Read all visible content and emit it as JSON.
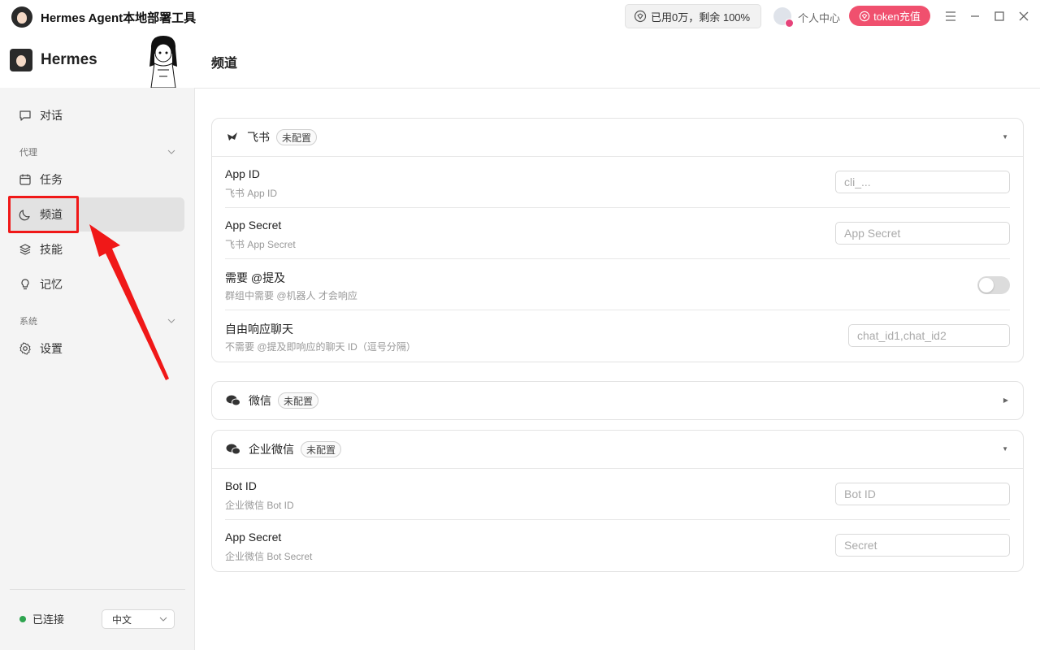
{
  "app": {
    "title": "Hermes Agent本地部署工具",
    "usage": "已用0万，剩余 100%",
    "profile": "个人中心",
    "recharge": "token充值"
  },
  "sidebar": {
    "brand": "Hermes",
    "items": [
      {
        "label": "对话",
        "icon": "chat-icon"
      },
      {
        "label": "任务",
        "icon": "calendar-icon"
      },
      {
        "label": "频道",
        "icon": "moon-icon",
        "active": true
      },
      {
        "label": "技能",
        "icon": "layers-icon"
      },
      {
        "label": "记忆",
        "icon": "lightbulb-icon"
      },
      {
        "label": "设置",
        "icon": "gear-icon"
      }
    ],
    "groups": {
      "agent": "代理",
      "system": "系统"
    },
    "status": "已连接",
    "language": "中文"
  },
  "page": {
    "title": "频道"
  },
  "channels": {
    "feishu": {
      "name": "飞书",
      "tag": "未配置",
      "fields": [
        {
          "label": "App ID",
          "hint": "飞书 App ID",
          "placeholder": "cli_..."
        },
        {
          "label": "App Secret",
          "hint": "飞书 App Secret",
          "placeholder": "App Secret"
        },
        {
          "label": "需要 @提及",
          "hint": "群组中需要 @机器人 才会响应",
          "toggle": false
        },
        {
          "label": "自由响应聊天",
          "hint": "不需要 @提及即响应的聊天 ID（逗号分隔）",
          "placeholder": "chat_id1,chat_id2"
        }
      ]
    },
    "wechat": {
      "name": "微信",
      "tag": "未配置"
    },
    "wecom": {
      "name": "企业微信",
      "tag": "未配置",
      "fields": [
        {
          "label": "Bot ID",
          "hint": "企业微信 Bot ID",
          "placeholder": "Bot ID"
        },
        {
          "label": "App Secret",
          "hint": "企业微信 Bot Secret",
          "placeholder": "Secret"
        }
      ]
    }
  },
  "colors": {
    "accent": "#f0506e",
    "annotation": "#f01818",
    "connected": "#2ea44f"
  }
}
